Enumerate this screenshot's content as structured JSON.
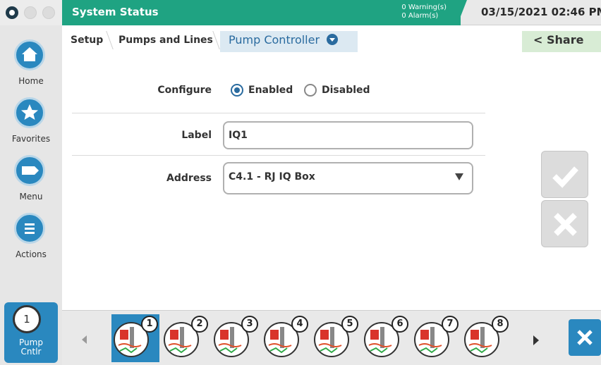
{
  "header": {
    "status_title": "System Status",
    "warnings": "0 Warning(s)",
    "alarms": "0 Alarm(s)",
    "datetime": "03/15/2021 02:46 PM",
    "status_color": "#1fa382"
  },
  "sidebar": {
    "items": [
      {
        "label": "Home",
        "icon": "house-icon"
      },
      {
        "label": "Favorites",
        "icon": "star-icon"
      },
      {
        "label": "Menu",
        "icon": "menu-icon"
      },
      {
        "label": "Actions",
        "icon": "list-icon"
      }
    ],
    "pump": {
      "number": "1",
      "label_line1": "Pump",
      "label_line2": "Cntlr"
    }
  },
  "breadcrumb": {
    "items": [
      "Setup",
      "Pumps and Lines"
    ],
    "active": "Pump Controller",
    "share": "Share"
  },
  "form": {
    "configure_label": "Configure",
    "enabled_label": "Enabled",
    "disabled_label": "Disabled",
    "configure_value": "Enabled",
    "label_label": "Label",
    "label_value": "IQ1",
    "address_label": "Address",
    "address_value": "C4.1 - RJ IQ Box"
  },
  "pumps": {
    "slots": [
      "1",
      "2",
      "3",
      "4",
      "5",
      "6",
      "7",
      "8"
    ],
    "selected": "1"
  },
  "colors": {
    "accent": "#2a88bf",
    "active_crumb": "#2a6b9f"
  }
}
